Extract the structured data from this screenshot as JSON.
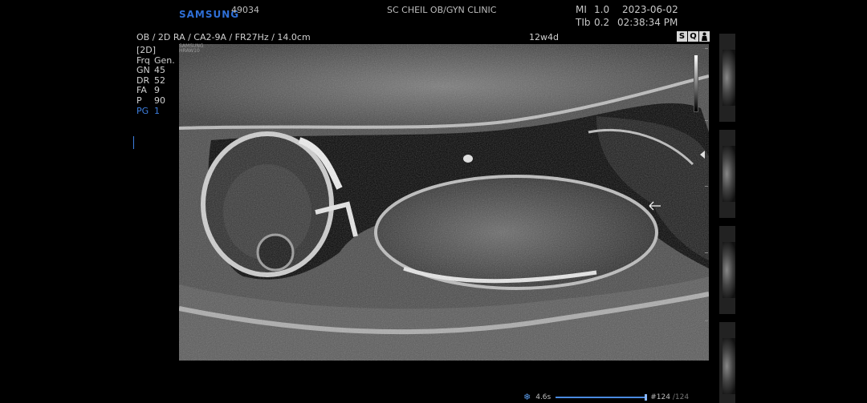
{
  "header": {
    "brand": "SAMSUNG",
    "patient_id": "49034",
    "clinic": "SC CHEIL OB/GYN CLINIC",
    "mi_label": "MI",
    "mi_value": "1.0",
    "tib_label": "TIb",
    "tib_value": "0.2",
    "date": "2023-06-02",
    "time": "02:38:34 PM"
  },
  "status_icons": [
    "S",
    "Q",
    "person-icon"
  ],
  "scan_params": {
    "line": "OB / 2D RA / CA2-9A / FR27Hz / 14.0cm",
    "gestational_age": "12w4d",
    "probe_label_1": "SAMSUNG",
    "probe_label_2": "HRAW10"
  },
  "side_params": {
    "mode": "[2D]",
    "rows": [
      {
        "k": "Frq",
        "v": "Gen."
      },
      {
        "k": "GN",
        "v": "45"
      },
      {
        "k": "DR",
        "v": "52"
      },
      {
        "k": "FA",
        "v": "9"
      },
      {
        "k": "P",
        "v": "90"
      },
      {
        "k": "PG",
        "v": "1"
      }
    ]
  },
  "cine": {
    "duration": "4.6s",
    "frame": "#124",
    "total": "/124",
    "progress": 1.0
  },
  "colors": {
    "brand": "#2f6fd6",
    "accent": "#3d7fe0"
  }
}
